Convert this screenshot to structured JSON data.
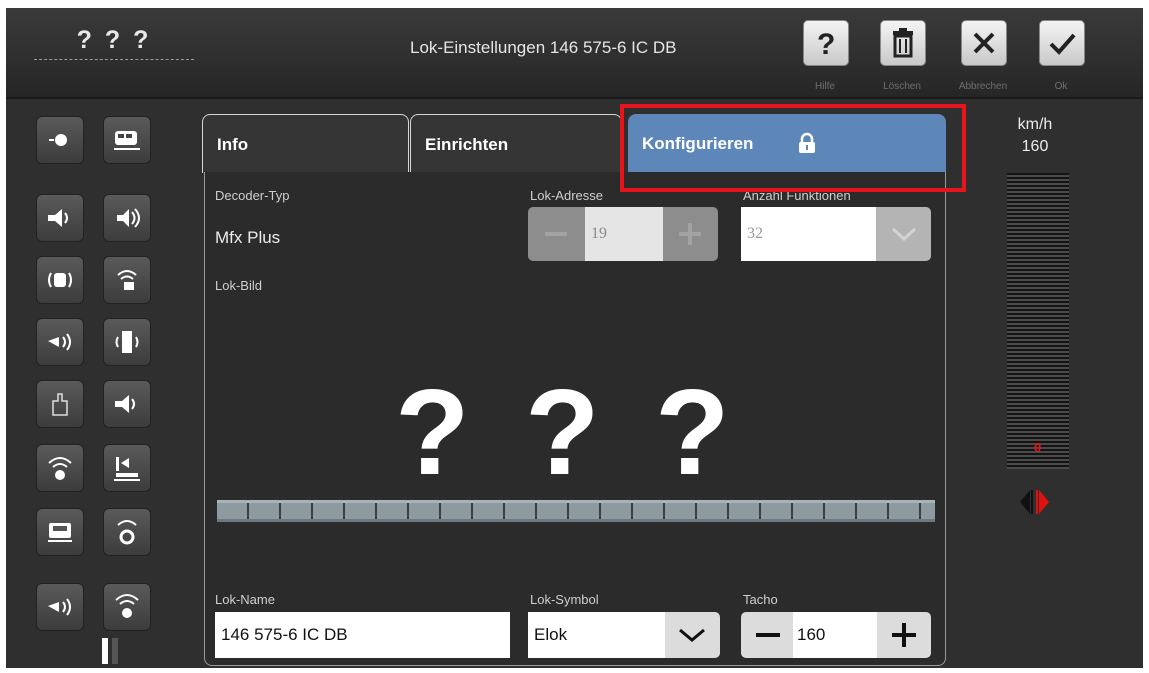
{
  "header": {
    "loco_short": "? ? ?",
    "title": "Lok-Einstellungen 146 575-6 IC DB",
    "buttons": [
      {
        "id": "help",
        "icon": "question-icon",
        "label": "Hilfe"
      },
      {
        "id": "delete",
        "icon": "trash-icon",
        "label": "Löschen"
      },
      {
        "id": "cancel",
        "icon": "close-icon",
        "label": "Abbrechen"
      },
      {
        "id": "ok",
        "icon": "check-icon",
        "label": "Ok"
      }
    ]
  },
  "function_icons": [
    "light-icon",
    "loco-icon",
    "horn-sound-icon",
    "sound-icon",
    "cab-light-icon",
    "signal-dim-icon",
    "whistle-icon",
    "door-sound-icon",
    "coupler-icon",
    "sound-alt-icon",
    "signal-wave-icon",
    "shunting-icon",
    "wagon-light-icon",
    "rotate-signal-icon",
    "horn-alt-icon",
    "antenna-icon"
  ],
  "tabs": {
    "info": "Info",
    "einrichten": "Einrichten",
    "konfigurieren": "Konfigurieren"
  },
  "form": {
    "decoder_label": "Decoder-Typ",
    "decoder_value": "Mfx Plus",
    "address_label": "Lok-Adresse",
    "address_value": "19",
    "functions_label": "Anzahl Funktionen",
    "functions_value": "32",
    "image_label": "Lok-Bild",
    "image_placeholder": [
      "?",
      "?",
      "?"
    ],
    "name_label": "Lok-Name",
    "name_value": "146 575-6 IC DB",
    "symbol_label": "Lok-Symbol",
    "symbol_value": "Elok",
    "tacho_label": "Tacho",
    "tacho_value": "160"
  },
  "speed": {
    "unit": "km/h",
    "max": "160",
    "current": "0",
    "direction": "forward"
  },
  "colors": {
    "active_tab": "#5d87b8",
    "highlight": "#e8141c",
    "direction_active": "#e11111"
  }
}
